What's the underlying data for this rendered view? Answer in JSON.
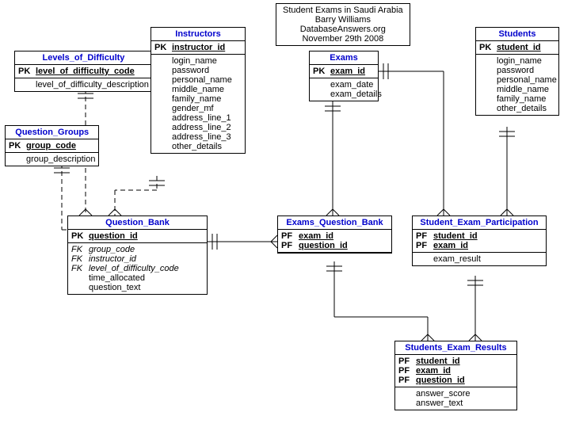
{
  "info": {
    "line1": "Student Exams in Saudi Arabia",
    "line2": "Barry Williams",
    "line3": "DatabaseAnswers.org",
    "line4": "November 29th 2008"
  },
  "entities": {
    "levels_of_difficulty": {
      "title": "Levels_of_Difficulty",
      "pk": [
        {
          "k": "PK",
          "a": "level_of_difficulty_code"
        }
      ],
      "attrs": [
        {
          "k": "",
          "a": "level_of_difficulty_description"
        }
      ]
    },
    "question_groups": {
      "title": "Question_Groups",
      "pk": [
        {
          "k": "PK",
          "a": "group_code"
        }
      ],
      "attrs": [
        {
          "k": "",
          "a": "group_description"
        }
      ]
    },
    "instructors": {
      "title": "Instructors",
      "pk": [
        {
          "k": "PK",
          "a": "instructor_id"
        }
      ],
      "attrs": [
        {
          "k": "",
          "a": "login_name"
        },
        {
          "k": "",
          "a": "password"
        },
        {
          "k": "",
          "a": "personal_name"
        },
        {
          "k": "",
          "a": "middle_name"
        },
        {
          "k": "",
          "a": "family_name"
        },
        {
          "k": "",
          "a": "gender_mf"
        },
        {
          "k": "",
          "a": "address_line_1"
        },
        {
          "k": "",
          "a": "address_line_2"
        },
        {
          "k": "",
          "a": "address_line_3"
        },
        {
          "k": "",
          "a": "other_details"
        }
      ]
    },
    "question_bank": {
      "title": "Question_Bank",
      "pk": [
        {
          "k": "PK",
          "a": "question_id"
        }
      ],
      "attrs": [
        {
          "k": "FK",
          "a": "group_code",
          "fk": true
        },
        {
          "k": "FK",
          "a": "instructor_id",
          "fk": true
        },
        {
          "k": "FK",
          "a": "level_of_difficulty_code",
          "fk": true
        },
        {
          "k": "",
          "a": "time_allocated"
        },
        {
          "k": "",
          "a": "question_text"
        }
      ]
    },
    "exams": {
      "title": "Exams",
      "pk": [
        {
          "k": "PK",
          "a": "exam_id"
        }
      ],
      "attrs": [
        {
          "k": "",
          "a": "exam_date"
        },
        {
          "k": "",
          "a": "exam_details"
        }
      ]
    },
    "exams_question_bank": {
      "title": "Exams_Question_Bank",
      "pk": [
        {
          "k": "PF",
          "a": "exam_id"
        },
        {
          "k": "PF",
          "a": "question_id"
        }
      ],
      "attrs": []
    },
    "students": {
      "title": "Students",
      "pk": [
        {
          "k": "PK",
          "a": "student_id"
        }
      ],
      "attrs": [
        {
          "k": "",
          "a": "login_name"
        },
        {
          "k": "",
          "a": "password"
        },
        {
          "k": "",
          "a": "personal_name"
        },
        {
          "k": "",
          "a": "middle_name"
        },
        {
          "k": "",
          "a": "family_name"
        },
        {
          "k": "",
          "a": "other_details"
        }
      ]
    },
    "student_exam_participation": {
      "title": "Student_Exam_Participation",
      "pk": [
        {
          "k": "PF",
          "a": "student_id"
        },
        {
          "k": "PF",
          "a": "exam_id"
        }
      ],
      "attrs": [
        {
          "k": "",
          "a": "exam_result"
        }
      ]
    },
    "students_exam_results": {
      "title": "Students_Exam_Results",
      "pk": [
        {
          "k": "PF",
          "a": "student_id"
        },
        {
          "k": "PF",
          "a": "exam_id"
        },
        {
          "k": "PF",
          "a": "question_id"
        }
      ],
      "attrs": [
        {
          "k": "",
          "a": "answer_score"
        },
        {
          "k": "",
          "a": "answer_text"
        }
      ]
    }
  }
}
